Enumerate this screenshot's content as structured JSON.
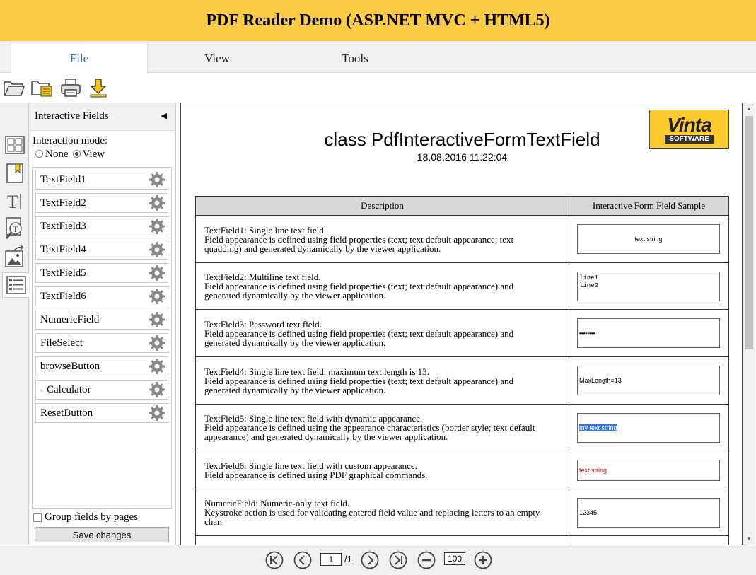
{
  "app": {
    "title": "PDF Reader Demo (ASP.NET MVC + HTML5)"
  },
  "tabs": [
    {
      "label": "File",
      "active": true
    },
    {
      "label": "View",
      "active": false
    },
    {
      "label": "Tools",
      "active": false
    }
  ],
  "toolbar": {
    "icons": [
      "open-folder-icon",
      "open-recent-icon",
      "print-icon",
      "download-icon"
    ]
  },
  "side_strip": {
    "icons": [
      "thumbnails-icon",
      "bookmarks-icon",
      "text-icon",
      "text-search-icon",
      "image-extract-icon",
      "interactive-fields-icon"
    ],
    "active": "interactive-fields-icon"
  },
  "panel": {
    "title": "Interactive Fields",
    "mode_label": "Interaction mode:",
    "mode_options": [
      {
        "label": "None",
        "selected": false
      },
      {
        "label": "View",
        "selected": true
      }
    ],
    "fields": [
      {
        "label": "TextField1"
      },
      {
        "label": "TextField2"
      },
      {
        "label": "TextField3"
      },
      {
        "label": "TextField4"
      },
      {
        "label": "TextField5"
      },
      {
        "label": "TextField6"
      },
      {
        "label": "NumericField"
      },
      {
        "label": "FileSelect"
      },
      {
        "label": "browseButton"
      },
      {
        "label": "Calculator",
        "expandable": true
      },
      {
        "label": "ResetButton"
      }
    ],
    "group_label": "Group fields by pages",
    "group_checked": false,
    "save_label": "Save changes"
  },
  "document": {
    "logo_text": "Vinta",
    "logo_sub": "SOFTWARE",
    "title": "class PdfInteractiveFormTextField",
    "date": "18.08.2016 11:22:04",
    "table": {
      "headers": [
        "Description",
        "Interactive Form Field Sample"
      ],
      "rows": [
        {
          "desc": [
            "TextField1: Single line text field.",
            "Field appearance is defined using field properties (text; text default appearance; text",
            "quadding) and generated dynamically by the viewer application."
          ],
          "sample": "text string"
        },
        {
          "desc": [
            "TextField2: Multiline text field.",
            "Field appearance is defined using field properties (text; text default appearance) and",
            "generated dynamically by the viewer application."
          ],
          "sample_lines": [
            "line1",
            "line2"
          ]
        },
        {
          "desc": [
            "TextField3: Password text field.",
            "Field appearance is defined using field properties (text; text default appearance) and",
            "generated dynamically by the viewer application."
          ],
          "sample": "••••••••"
        },
        {
          "desc": [
            "TextField4: Single line text field, maximum text length is 13.",
            "Field appearance is defined using field properties (text; text default appearance) and",
            "generated dynamically by the viewer application."
          ],
          "sample": "MaxLength=13"
        },
        {
          "desc": [
            "TextField5: Single line text field with dynamic appearance.",
            "Field appearance is defined using the appearance characteristics (border style; text default",
            "appearance) and generated dynamically by the viewer application."
          ],
          "sample": "my text string"
        },
        {
          "desc": [
            "TextField6: Single line text field with custom appearance.",
            "Field appearance is defined using PDF graphical commands."
          ],
          "sample": "text string",
          "sample_color": "#cc0000"
        },
        {
          "desc": [
            "NumericField: Numeric-only text field.",
            "Keystroke action is used for validating entered field value and replacing letters to an empty",
            "char."
          ],
          "sample": "12345"
        }
      ]
    }
  },
  "footer": {
    "page_current": "1",
    "page_total": "/1",
    "zoom": "100"
  }
}
